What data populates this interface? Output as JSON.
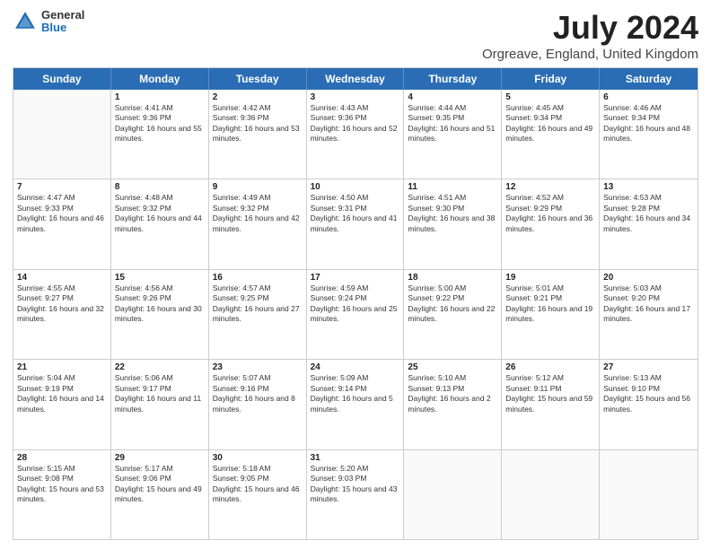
{
  "header": {
    "logo": {
      "general": "General",
      "blue": "Blue"
    },
    "title": "July 2024",
    "subtitle": "Orgreave, England, United Kingdom"
  },
  "calendar": {
    "weekdays": [
      "Sunday",
      "Monday",
      "Tuesday",
      "Wednesday",
      "Thursday",
      "Friday",
      "Saturday"
    ],
    "rows": [
      [
        {
          "day": "",
          "empty": true
        },
        {
          "day": "1",
          "sunrise": "Sunrise: 4:41 AM",
          "sunset": "Sunset: 9:36 PM",
          "daylight": "Daylight: 16 hours and 55 minutes."
        },
        {
          "day": "2",
          "sunrise": "Sunrise: 4:42 AM",
          "sunset": "Sunset: 9:36 PM",
          "daylight": "Daylight: 16 hours and 53 minutes."
        },
        {
          "day": "3",
          "sunrise": "Sunrise: 4:43 AM",
          "sunset": "Sunset: 9:36 PM",
          "daylight": "Daylight: 16 hours and 52 minutes."
        },
        {
          "day": "4",
          "sunrise": "Sunrise: 4:44 AM",
          "sunset": "Sunset: 9:35 PM",
          "daylight": "Daylight: 16 hours and 51 minutes."
        },
        {
          "day": "5",
          "sunrise": "Sunrise: 4:45 AM",
          "sunset": "Sunset: 9:34 PM",
          "daylight": "Daylight: 16 hours and 49 minutes."
        },
        {
          "day": "6",
          "sunrise": "Sunrise: 4:46 AM",
          "sunset": "Sunset: 9:34 PM",
          "daylight": "Daylight: 16 hours and 48 minutes."
        }
      ],
      [
        {
          "day": "7",
          "sunrise": "Sunrise: 4:47 AM",
          "sunset": "Sunset: 9:33 PM",
          "daylight": "Daylight: 16 hours and 46 minutes."
        },
        {
          "day": "8",
          "sunrise": "Sunrise: 4:48 AM",
          "sunset": "Sunset: 9:32 PM",
          "daylight": "Daylight: 16 hours and 44 minutes."
        },
        {
          "day": "9",
          "sunrise": "Sunrise: 4:49 AM",
          "sunset": "Sunset: 9:32 PM",
          "daylight": "Daylight: 16 hours and 42 minutes."
        },
        {
          "day": "10",
          "sunrise": "Sunrise: 4:50 AM",
          "sunset": "Sunset: 9:31 PM",
          "daylight": "Daylight: 16 hours and 41 minutes."
        },
        {
          "day": "11",
          "sunrise": "Sunrise: 4:51 AM",
          "sunset": "Sunset: 9:30 PM",
          "daylight": "Daylight: 16 hours and 38 minutes."
        },
        {
          "day": "12",
          "sunrise": "Sunrise: 4:52 AM",
          "sunset": "Sunset: 9:29 PM",
          "daylight": "Daylight: 16 hours and 36 minutes."
        },
        {
          "day": "13",
          "sunrise": "Sunrise: 4:53 AM",
          "sunset": "Sunset: 9:28 PM",
          "daylight": "Daylight: 16 hours and 34 minutes."
        }
      ],
      [
        {
          "day": "14",
          "sunrise": "Sunrise: 4:55 AM",
          "sunset": "Sunset: 9:27 PM",
          "daylight": "Daylight: 16 hours and 32 minutes."
        },
        {
          "day": "15",
          "sunrise": "Sunrise: 4:56 AM",
          "sunset": "Sunset: 9:26 PM",
          "daylight": "Daylight: 16 hours and 30 minutes."
        },
        {
          "day": "16",
          "sunrise": "Sunrise: 4:57 AM",
          "sunset": "Sunset: 9:25 PM",
          "daylight": "Daylight: 16 hours and 27 minutes."
        },
        {
          "day": "17",
          "sunrise": "Sunrise: 4:59 AM",
          "sunset": "Sunset: 9:24 PM",
          "daylight": "Daylight: 16 hours and 25 minutes."
        },
        {
          "day": "18",
          "sunrise": "Sunrise: 5:00 AM",
          "sunset": "Sunset: 9:22 PM",
          "daylight": "Daylight: 16 hours and 22 minutes."
        },
        {
          "day": "19",
          "sunrise": "Sunrise: 5:01 AM",
          "sunset": "Sunset: 9:21 PM",
          "daylight": "Daylight: 16 hours and 19 minutes."
        },
        {
          "day": "20",
          "sunrise": "Sunrise: 5:03 AM",
          "sunset": "Sunset: 9:20 PM",
          "daylight": "Daylight: 16 hours and 17 minutes."
        }
      ],
      [
        {
          "day": "21",
          "sunrise": "Sunrise: 5:04 AM",
          "sunset": "Sunset: 9:19 PM",
          "daylight": "Daylight: 16 hours and 14 minutes."
        },
        {
          "day": "22",
          "sunrise": "Sunrise: 5:06 AM",
          "sunset": "Sunset: 9:17 PM",
          "daylight": "Daylight: 16 hours and 11 minutes."
        },
        {
          "day": "23",
          "sunrise": "Sunrise: 5:07 AM",
          "sunset": "Sunset: 9:16 PM",
          "daylight": "Daylight: 16 hours and 8 minutes."
        },
        {
          "day": "24",
          "sunrise": "Sunrise: 5:09 AM",
          "sunset": "Sunset: 9:14 PM",
          "daylight": "Daylight: 16 hours and 5 minutes."
        },
        {
          "day": "25",
          "sunrise": "Sunrise: 5:10 AM",
          "sunset": "Sunset: 9:13 PM",
          "daylight": "Daylight: 16 hours and 2 minutes."
        },
        {
          "day": "26",
          "sunrise": "Sunrise: 5:12 AM",
          "sunset": "Sunset: 9:11 PM",
          "daylight": "Daylight: 15 hours and 59 minutes."
        },
        {
          "day": "27",
          "sunrise": "Sunrise: 5:13 AM",
          "sunset": "Sunset: 9:10 PM",
          "daylight": "Daylight: 15 hours and 56 minutes."
        }
      ],
      [
        {
          "day": "28",
          "sunrise": "Sunrise: 5:15 AM",
          "sunset": "Sunset: 9:08 PM",
          "daylight": "Daylight: 15 hours and 53 minutes."
        },
        {
          "day": "29",
          "sunrise": "Sunrise: 5:17 AM",
          "sunset": "Sunset: 9:06 PM",
          "daylight": "Daylight: 15 hours and 49 minutes."
        },
        {
          "day": "30",
          "sunrise": "Sunrise: 5:18 AM",
          "sunset": "Sunset: 9:05 PM",
          "daylight": "Daylight: 15 hours and 46 minutes."
        },
        {
          "day": "31",
          "sunrise": "Sunrise: 5:20 AM",
          "sunset": "Sunset: 9:03 PM",
          "daylight": "Daylight: 15 hours and 43 minutes."
        },
        {
          "day": "",
          "empty": true
        },
        {
          "day": "",
          "empty": true
        },
        {
          "day": "",
          "empty": true
        }
      ]
    ]
  }
}
